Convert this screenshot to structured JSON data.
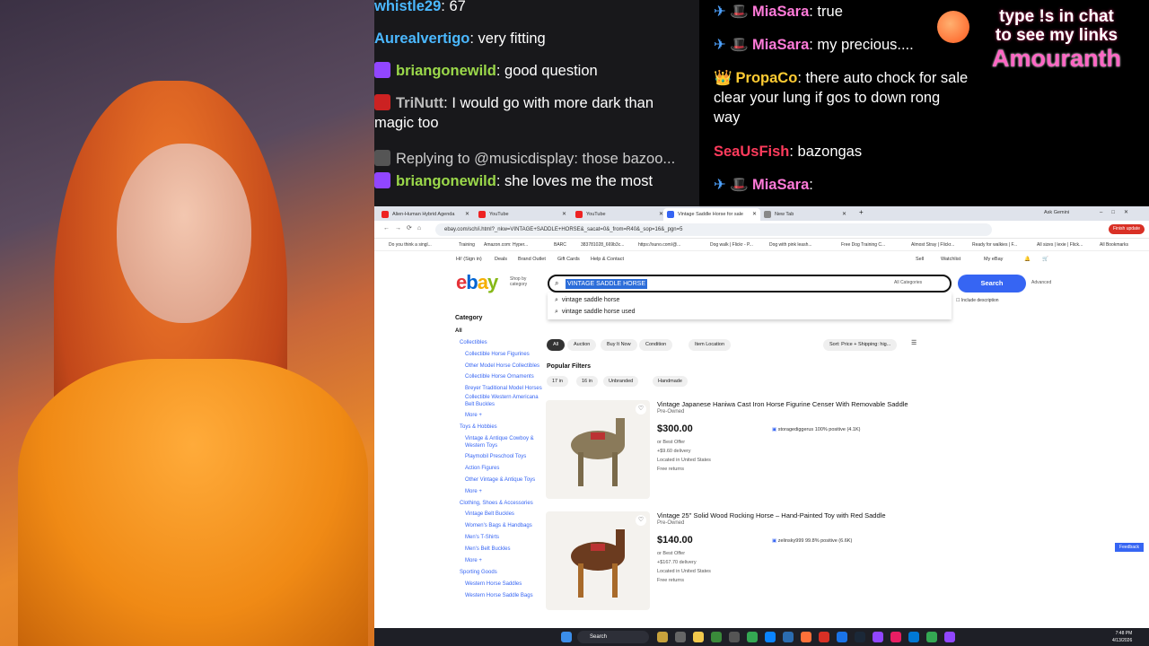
{
  "chat_left": [
    {
      "user": "whistle29",
      "text": ": 67",
      "user_color": "#4bb8ff",
      "badge": null
    },
    {
      "user": "Aurealvertigo",
      "text": ": very fitting",
      "user_color": "#4bb8ff",
      "badge": null
    },
    {
      "user": "briangonewild",
      "text": ": good question",
      "user_color": "#9bd84a",
      "badge": "#9146ff"
    },
    {
      "user": "TriNutt",
      "text": ": I would go with more dark than magic too",
      "user_color": "#bbbbbb",
      "badge": "#cc2222"
    },
    {
      "user": "",
      "text": "Replying to @musicdisplay: those bazoo...",
      "user_color": "#cccccc",
      "badge": "#555"
    },
    {
      "user": "briangonewild",
      "text": ": she loves me the most",
      "user_color": "#9bd84a",
      "badge": "#9146ff"
    }
  ],
  "chat_right": [
    {
      "user": "MiaSara",
      "text": ": true",
      "user_color": "#ff7ad9",
      "prefix": "✈ 🎩"
    },
    {
      "user": "MiaSara",
      "text": ": my precious....",
      "user_color": "#ff7ad9",
      "prefix": "✈ 🎩"
    },
    {
      "user": "PropaCo",
      "text": ": there auto chock for sale clear your lung if gos to down rong way",
      "user_color": "#ffcc33",
      "prefix": "👑"
    },
    {
      "user": "SeaUsFish",
      "text": ": bazongas",
      "user_color": "#ff3b5c",
      "prefix": ""
    },
    {
      "user": "MiaSara",
      "text": ": ",
      "user_color": "#ff7ad9",
      "prefix": "✈ 🎩"
    }
  ],
  "brand": {
    "line1": "type !s in chat",
    "line2": "to see my links",
    "name": "Amouranth"
  },
  "browser": {
    "tabs": [
      "Alien-Human Hybrid Agenda",
      "YouTube",
      "YouTube",
      "Vintage Saddle Horse for sale",
      "New Tab"
    ],
    "ask_gemini": "Ask Gemini",
    "url": "ebay.com/sch/i.html?_nkw=VINTAGE+SADDLE+HORSE&_sacat=0&_from=R40&_sop=16&_pgn=5",
    "finish_update": "Finish update",
    "bookmarks": [
      "Do you think a singl...",
      "Training",
      "Amazon.com: Hyper...",
      "BARC",
      "383781028_669b3c...",
      "https://suno.com/@...",
      "Dog walk | Flickr - P...",
      "Dog with pink leash...",
      "Free Dog Training C...",
      "Almost Stray | Flickr...",
      "Ready for walkies | F...",
      "All sizes | lexie | Flick...",
      "All Bookmarks"
    ],
    "nav": {
      "greeting": "Hi! (Sign in)",
      "deals": "Deals",
      "brand_outlet": "Brand Outlet",
      "gift_cards": "Gift Cards",
      "help": "Help & Contact",
      "sell": "Sell",
      "watchlist": "Watchlist",
      "my_ebay": "My eBay"
    },
    "logo": "ebay",
    "shop_by": "Shop by category",
    "search_value": "VINTAGE SADDLE HORSE",
    "all_categories": "All Categories",
    "search_button": "Search",
    "advanced": "Advanced",
    "include_desc": "Include description",
    "suggestions": [
      "vintage saddle horse",
      "vintage saddle horse used"
    ],
    "sidebar_title": "Category",
    "sidebar": [
      "All",
      "Collectibles",
      "Collectible Horse Figurines",
      "Other Model Horse Collectibles",
      "Collectible Horse Ornaments",
      "Breyer Traditional Model Horses",
      "Collectible Western Americana Belt Buckles",
      "More +",
      "Toys & Hobbies",
      "Vintage & Antique Cowboy & Western Toys",
      "Playmobil Preschool Toys",
      "Action Figures",
      "Other Vintage & Antique Toys",
      "More +",
      "Clothing, Shoes & Accessories",
      "Vintage Belt Buckles",
      "Women's Bags & Handbags",
      "Men's T-Shirts",
      "Men's Belt Buckles",
      "More +",
      "Sporting Goods",
      "Western Horse Saddles",
      "Western Horse Saddle Bags"
    ],
    "filters": [
      "All",
      "Auction",
      "Buy It Now",
      "Condition",
      "Item Location"
    ],
    "sort": "Sort: Price + Shipping: hig...",
    "popular_title": "Popular Filters",
    "popular": [
      "17 in",
      "16 in",
      "Unbranded",
      "Handmade"
    ],
    "items": [
      {
        "title": "Vintage Japanese Haniwa Cast Iron Horse Figurine Censer With Removable Saddle",
        "condition": "Pre-Owned",
        "price": "$300.00",
        "offer": "or Best Offer",
        "delivery": "+$9.60 delivery",
        "location": "Located in United States",
        "returns": "Free returns",
        "seller": "storagediggerus 100% positive (4.1K)"
      },
      {
        "title": "Vintage 25\" Solid Wood Rocking Horse – Hand-Painted Toy with Red Saddle",
        "condition": "Pre-Owned",
        "price": "$140.00",
        "offer": "or Best Offer",
        "delivery": "+$167.70 delivery",
        "location": "Located in United States",
        "returns": "Free returns",
        "seller": "zelinsky999 99.8% positive (6.6K)"
      }
    ],
    "feedback": "Feedback"
  },
  "taskbar": {
    "search": "Search",
    "time": "7:48 PM",
    "date": "4/13/2026"
  }
}
